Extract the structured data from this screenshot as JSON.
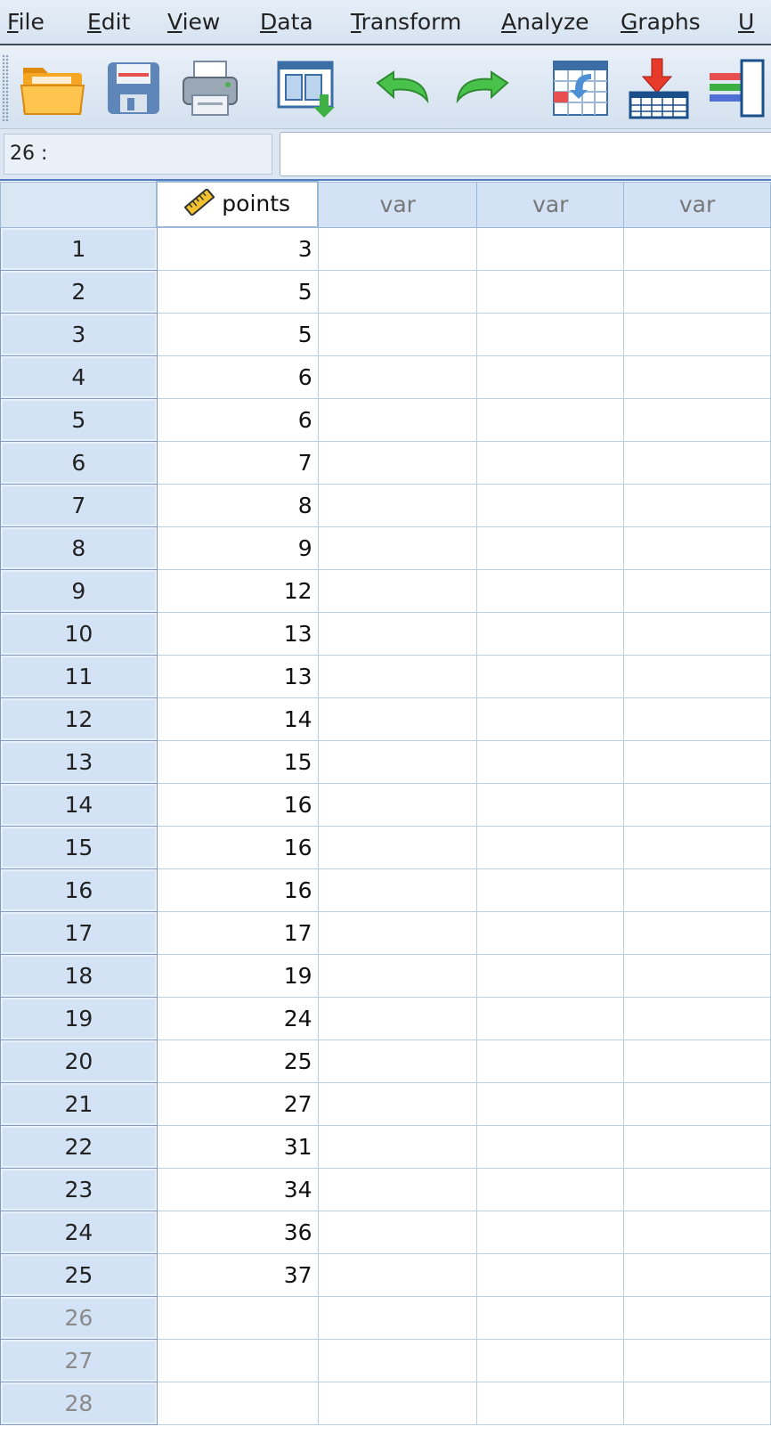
{
  "menu": {
    "items": [
      {
        "pre": "",
        "acc": "F",
        "post": "ile"
      },
      {
        "pre": "",
        "acc": "E",
        "post": "dit"
      },
      {
        "pre": "",
        "acc": "V",
        "post": "iew"
      },
      {
        "pre": "",
        "acc": "D",
        "post": "ata"
      },
      {
        "pre": "",
        "acc": "T",
        "post": "ransform"
      },
      {
        "pre": "",
        "acc": "A",
        "post": "nalyze"
      },
      {
        "pre": "",
        "acc": "G",
        "post": "raphs"
      },
      {
        "pre": "",
        "acc": "U",
        "post": ""
      }
    ]
  },
  "toolbar": {
    "icons": [
      "open-folder-icon",
      "save-icon",
      "print-icon",
      "recall-dialog-icon",
      "undo-icon",
      "redo-icon",
      "goto-case-icon",
      "insert-cases-icon",
      "insert-variable-icon"
    ]
  },
  "cell_bar": {
    "reference": "26 :",
    "value": ""
  },
  "grid": {
    "columns": [
      {
        "name": "points",
        "named": true,
        "measure_icon": "scale-ruler-icon"
      },
      {
        "name": "var",
        "named": false
      },
      {
        "name": "var",
        "named": false
      },
      {
        "name": "var",
        "named": false
      }
    ],
    "rows": [
      {
        "n": "1",
        "points": "3"
      },
      {
        "n": "2",
        "points": "5"
      },
      {
        "n": "3",
        "points": "5"
      },
      {
        "n": "4",
        "points": "6"
      },
      {
        "n": "5",
        "points": "6"
      },
      {
        "n": "6",
        "points": "7"
      },
      {
        "n": "7",
        "points": "8"
      },
      {
        "n": "8",
        "points": "9"
      },
      {
        "n": "9",
        "points": "12"
      },
      {
        "n": "10",
        "points": "13"
      },
      {
        "n": "11",
        "points": "13"
      },
      {
        "n": "12",
        "points": "14"
      },
      {
        "n": "13",
        "points": "15"
      },
      {
        "n": "14",
        "points": "16"
      },
      {
        "n": "15",
        "points": "16"
      },
      {
        "n": "16",
        "points": "16"
      },
      {
        "n": "17",
        "points": "17"
      },
      {
        "n": "18",
        "points": "19"
      },
      {
        "n": "19",
        "points": "24"
      },
      {
        "n": "20",
        "points": "25"
      },
      {
        "n": "21",
        "points": "27"
      },
      {
        "n": "22",
        "points": "31"
      },
      {
        "n": "23",
        "points": "34"
      },
      {
        "n": "24",
        "points": "36"
      },
      {
        "n": "25",
        "points": "37"
      },
      {
        "n": "26",
        "points": "",
        "empty": true
      },
      {
        "n": "27",
        "points": "",
        "empty": true
      },
      {
        "n": "28",
        "points": "",
        "empty": true
      }
    ]
  },
  "colors": {
    "accent": "#4f7fbf",
    "row_header": "#d3e3f5",
    "grid_line": "#b9cfe6"
  }
}
